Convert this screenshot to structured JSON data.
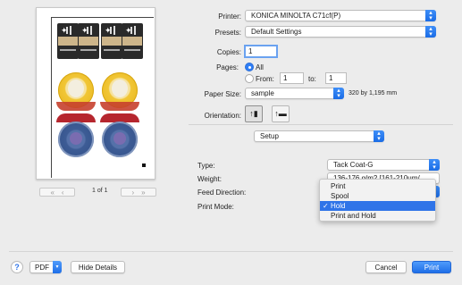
{
  "preview": {
    "page_indicator": "1 of 1",
    "first_page_icon": "double-chevron-left-icon",
    "prev_page_icon": "chevron-left-icon",
    "next_page_icon": "chevron-right-icon",
    "last_page_icon": "double-chevron-right-icon"
  },
  "form": {
    "printer_label": "Printer:",
    "printer_value": "KONICA MINOLTA C71cf(P)",
    "presets_label": "Presets:",
    "presets_value": "Default Settings",
    "copies_label": "Copies:",
    "copies_value": "1",
    "pages_label": "Pages:",
    "pages_all": "All",
    "pages_from": "From:",
    "pages_from_value": "1",
    "pages_to": "to:",
    "pages_to_value": "1",
    "paper_size_label": "Paper Size:",
    "paper_size_value": "sample",
    "paper_size_dims": "320 by 1,195 mm",
    "orientation_label": "Orientation:",
    "section_popup": "Setup",
    "type_label": "Type:",
    "type_value": "Tack Coat-G",
    "weight_label": "Weight:",
    "weight_value": "136-176 g/m2 [161-210μm/",
    "feed_label": "Feed Direction:",
    "print_mode_label": "Print Mode:"
  },
  "print_mode_menu": {
    "items": [
      "Print",
      "Spool",
      "Hold",
      "Print and Hold"
    ],
    "selected": "Hold",
    "check": "✓"
  },
  "bottom": {
    "help": "?",
    "pdf": "PDF",
    "hide_details": "Hide Details",
    "cancel": "Cancel",
    "print": "Print"
  },
  "colors": {
    "accent": "#2f74e8",
    "window_bg": "#ececec"
  }
}
